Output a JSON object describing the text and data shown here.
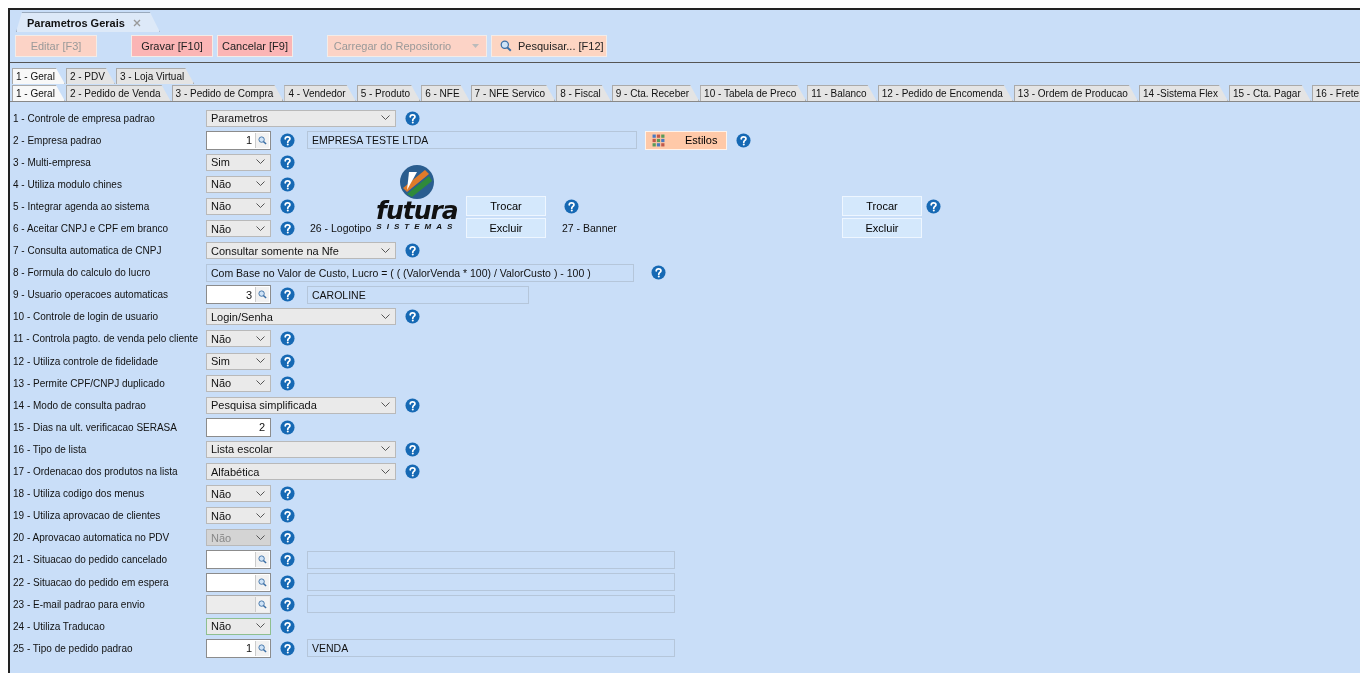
{
  "document_tab": {
    "title": "Parametros Gerais",
    "selected": true
  },
  "toolbar": [
    {
      "label": "Editar [F3]",
      "kind": "button",
      "disabled": true,
      "color": "#fcd3c6"
    },
    {
      "label": "Gravar [F10]",
      "kind": "button",
      "disabled": false,
      "color": "#fbb5b5"
    },
    {
      "label": "Cancelar [F9]",
      "kind": "button",
      "disabled": false,
      "color": "#fbb5b5"
    },
    {
      "label": "Carregar do Repositorio",
      "kind": "dropdown",
      "disabled": true,
      "color": "#fcd3c6"
    },
    {
      "label": "Pesquisar... [F12]",
      "kind": "search",
      "disabled": false,
      "color": "#fdd5c2"
    }
  ],
  "tabs_top": [
    {
      "label": "1 - Geral",
      "selected": true
    },
    {
      "label": "2 - PDV",
      "selected": false
    },
    {
      "label": "3 - Loja Virtual",
      "selected": false
    }
  ],
  "tabs_sub": [
    {
      "label": "1 - Geral",
      "selected": true
    },
    {
      "label": "2 - Pedido de Venda",
      "selected": false
    },
    {
      "label": "3 - Pedido de Compra",
      "selected": false
    },
    {
      "label": "4 - Vendedor",
      "selected": false
    },
    {
      "label": "5 - Produto",
      "selected": false
    },
    {
      "label": "6 - NFE",
      "selected": false
    },
    {
      "label": "7 - NFE Servico",
      "selected": false
    },
    {
      "label": "8 - Fiscal",
      "selected": false
    },
    {
      "label": "9 - Cta. Receber",
      "selected": false
    },
    {
      "label": "10 - Tabela de Preco",
      "selected": false
    },
    {
      "label": "11 - Balanco",
      "selected": false
    },
    {
      "label": "12 - Pedido de Encomenda",
      "selected": false
    },
    {
      "label": "13 - Ordem de Producao",
      "selected": false
    },
    {
      "label": "14 -Sistema Flex",
      "selected": false
    },
    {
      "label": "15 - Cta. Pagar",
      "selected": false
    },
    {
      "label": "16 - Frete",
      "selected": false
    }
  ],
  "params": [
    {
      "label": "1 - Controle de empresa padrao",
      "kind": "select",
      "value": "Parametros",
      "disabled": false,
      "focused": false
    },
    {
      "label": "2 - Empresa padrao",
      "kind": "lookup",
      "value": "1",
      "description": "EMPRESA TESTE LTDA",
      "disabled": false,
      "focused": false,
      "styles_button": "Estilos"
    },
    {
      "label": "3 - Multi-empresa",
      "kind": "choice",
      "value": "Sim",
      "disabled": false,
      "focused": false
    },
    {
      "label": "4 - Utiliza modulo chines",
      "kind": "choice",
      "value": "Não",
      "disabled": false,
      "focused": false
    },
    {
      "label": "5 - Integrar agenda ao sistema",
      "kind": "choice",
      "value": "Não",
      "disabled": false,
      "focused": false
    },
    {
      "label": "6 - Aceitar CNPJ e CPF em branco",
      "kind": "choice",
      "value": "Não",
      "disabled": false,
      "focused": false
    },
    {
      "label": "7 - Consulta automatica de CNPJ",
      "kind": "select",
      "value": "Consultar somente na Nfe",
      "disabled": false,
      "focused": false
    },
    {
      "label": "8 - Formula do calculo do lucro",
      "kind": "formula",
      "value": "Com Base no Valor de Custo, Lucro = ( ( (ValorVenda * 100) / ValorCusto ) - 100 )"
    },
    {
      "label": "9 - Usuario operacoes automaticas",
      "kind": "lookup",
      "value": "3",
      "description": "CAROLINE",
      "disabled": false,
      "focused": false
    },
    {
      "label": "10 - Controle de login de usuario",
      "kind": "select",
      "value": "Login/Senha",
      "disabled": false,
      "focused": false
    },
    {
      "label": "11 - Controla pagto. de venda pelo cliente",
      "kind": "choice",
      "value": "Não",
      "disabled": false,
      "focused": false
    },
    {
      "label": "12 - Utiliza controle de fidelidade",
      "kind": "choice",
      "value": "Sim",
      "disabled": false,
      "focused": false
    },
    {
      "label": "13 - Permite CPF/CNPJ duplicado",
      "kind": "choice",
      "value": "Não",
      "disabled": false,
      "focused": false
    },
    {
      "label": "14 - Modo de consulta padrao",
      "kind": "select",
      "value": "Pesquisa simplificada",
      "disabled": false,
      "focused": false
    },
    {
      "label": "15 - Dias na ult. verificacao SERASA",
      "kind": "number",
      "value": "2",
      "disabled": false,
      "focused": false
    },
    {
      "label": "16 - Tipo de lista",
      "kind": "select",
      "value": "Lista escolar",
      "disabled": false,
      "focused": false
    },
    {
      "label": "17 - Ordenacao dos produtos na lista",
      "kind": "select",
      "value": "Alfabética",
      "disabled": false,
      "focused": false
    },
    {
      "label": "18 - Utiliza codigo dos menus",
      "kind": "choice",
      "value": "Não",
      "disabled": false,
      "focused": false
    },
    {
      "label": "19 - Utiliza aprovacao de clientes",
      "kind": "choice",
      "value": "Não",
      "disabled": false,
      "focused": false
    },
    {
      "label": "20 - Aprovacao automatica no PDV",
      "kind": "choice",
      "value": "Não",
      "disabled": true,
      "focused": false
    },
    {
      "label": "21 - Situacao do pedido cancelado",
      "kind": "lookup",
      "disabled": false,
      "focused": false,
      "wide": true
    },
    {
      "label": "22 - Situacao do pedido em espera",
      "kind": "lookup",
      "disabled": false,
      "focused": false,
      "wide": true
    },
    {
      "label": "23 - E-mail padrao para envio",
      "kind": "lookup",
      "disabled": true,
      "focused": false,
      "wide": true
    },
    {
      "label": "24 - Utiliza Traducao",
      "kind": "choice",
      "value": "Não",
      "disabled": false,
      "focused": true
    },
    {
      "label": "25 - Tipo de pedido padrao",
      "kind": "lookup",
      "value": "1",
      "description": "VENDA",
      "disabled": false,
      "focused": false,
      "wide": true
    }
  ],
  "images": {
    "logo_label": "26 - Logotipo",
    "logo": {
      "wordmark": "futura",
      "tagline": "SISTEMAS"
    },
    "logo_buttons": [
      "Trocar",
      "Excluir"
    ],
    "banner_label": "27 - Banner",
    "banner_buttons": [
      "Trocar",
      "Excluir"
    ]
  }
}
